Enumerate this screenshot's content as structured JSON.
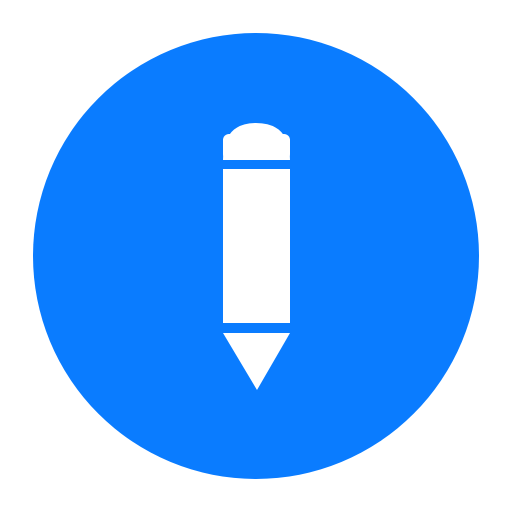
{
  "app_icon": {
    "name": "pencil-icon",
    "role": "edit",
    "colors": {
      "background": "#ffffff",
      "circle": "#0a7cff",
      "glyph": "#ffffff"
    }
  }
}
